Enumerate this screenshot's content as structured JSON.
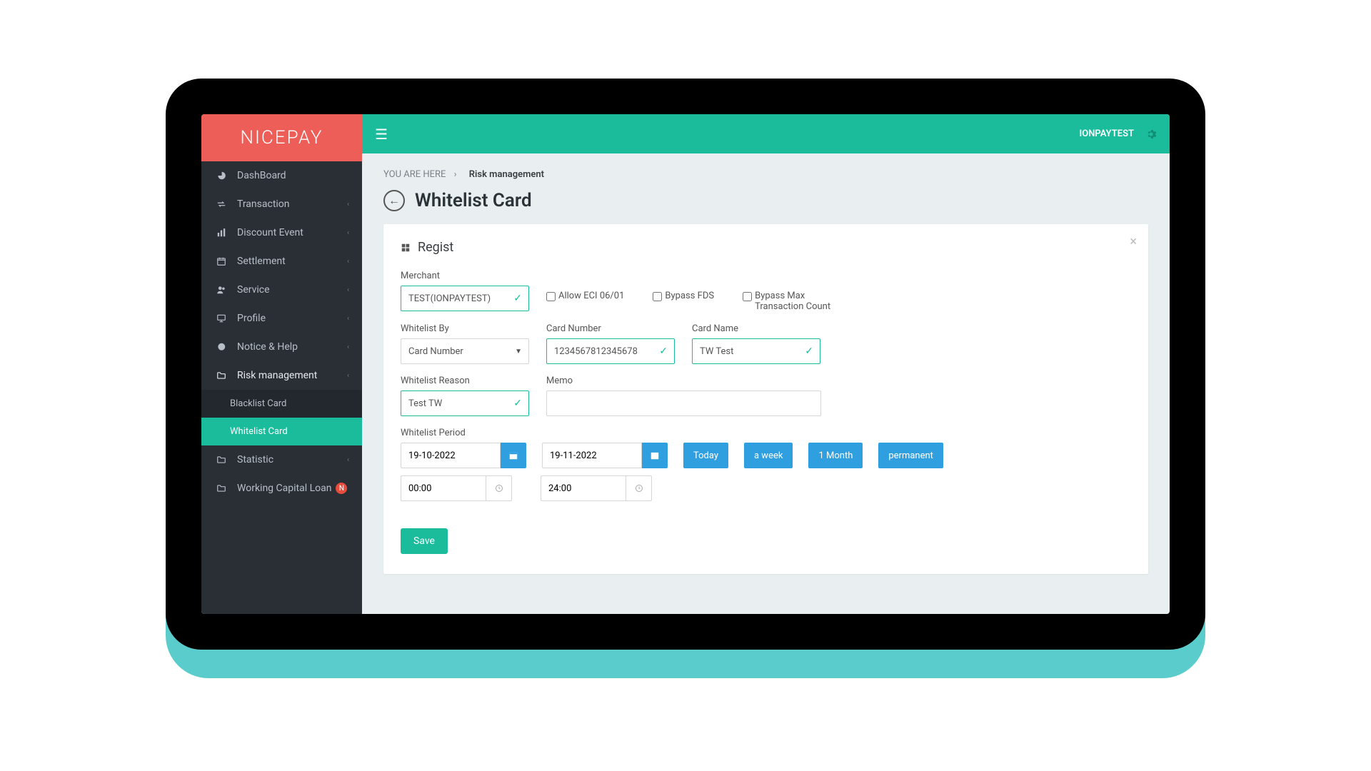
{
  "brand": "NICEPAY",
  "topbar": {
    "username": "IONPAYTEST"
  },
  "sidebar": {
    "items": [
      {
        "label": "DashBoard",
        "icon": "dashboard"
      },
      {
        "label": "Transaction",
        "icon": "exchange",
        "chevron": true
      },
      {
        "label": "Discount Event",
        "icon": "bar-chart",
        "chevron": true
      },
      {
        "label": "Settlement",
        "icon": "calendar",
        "chevron": true
      },
      {
        "label": "Service",
        "icon": "users",
        "chevron": true
      },
      {
        "label": "Profile",
        "icon": "monitor",
        "chevron": true
      },
      {
        "label": "Notice & Help",
        "icon": "chat",
        "chevron": true
      },
      {
        "label": "Risk management",
        "icon": "folder",
        "chevron": true,
        "expanded": true,
        "sub": [
          {
            "label": "Blacklist Card"
          },
          {
            "label": "Whitelist Card",
            "active": true
          }
        ]
      },
      {
        "label": "Statistic",
        "icon": "folder",
        "chevron": true
      },
      {
        "label": "Working Capital Loan",
        "icon": "folder",
        "badge": "N",
        "chevron": true
      }
    ]
  },
  "breadcrumb": {
    "prefix": "YOU ARE HERE",
    "sep": "›",
    "current": "Risk management"
  },
  "page": {
    "title": "Whitelist Card"
  },
  "panel": {
    "title": "Regist"
  },
  "form": {
    "merchant": {
      "label": "Merchant",
      "value": "TEST(IONPAYTEST)"
    },
    "checkboxes": {
      "eci": "Allow ECI 06/01",
      "bypass_fds": "Bypass FDS",
      "bypass_max": "Bypass Max Transaction Count"
    },
    "whitelist_by": {
      "label": "Whitelist By",
      "value": "Card Number"
    },
    "card_number": {
      "label": "Card Number",
      "value": "1234567812345678"
    },
    "card_name": {
      "label": "Card Name",
      "value": "TW Test"
    },
    "whitelist_reason": {
      "label": "Whitelist Reason",
      "value": "Test TW"
    },
    "memo": {
      "label": "Memo",
      "value": ""
    },
    "period": {
      "label": "Whitelist Period",
      "start_date": "19-10-2022",
      "end_date": "19-11-2022",
      "start_time": "00:00",
      "end_time": "24:00",
      "quick": [
        "Today",
        "a week",
        "1 Month",
        "permanent"
      ]
    },
    "save_label": "Save"
  }
}
